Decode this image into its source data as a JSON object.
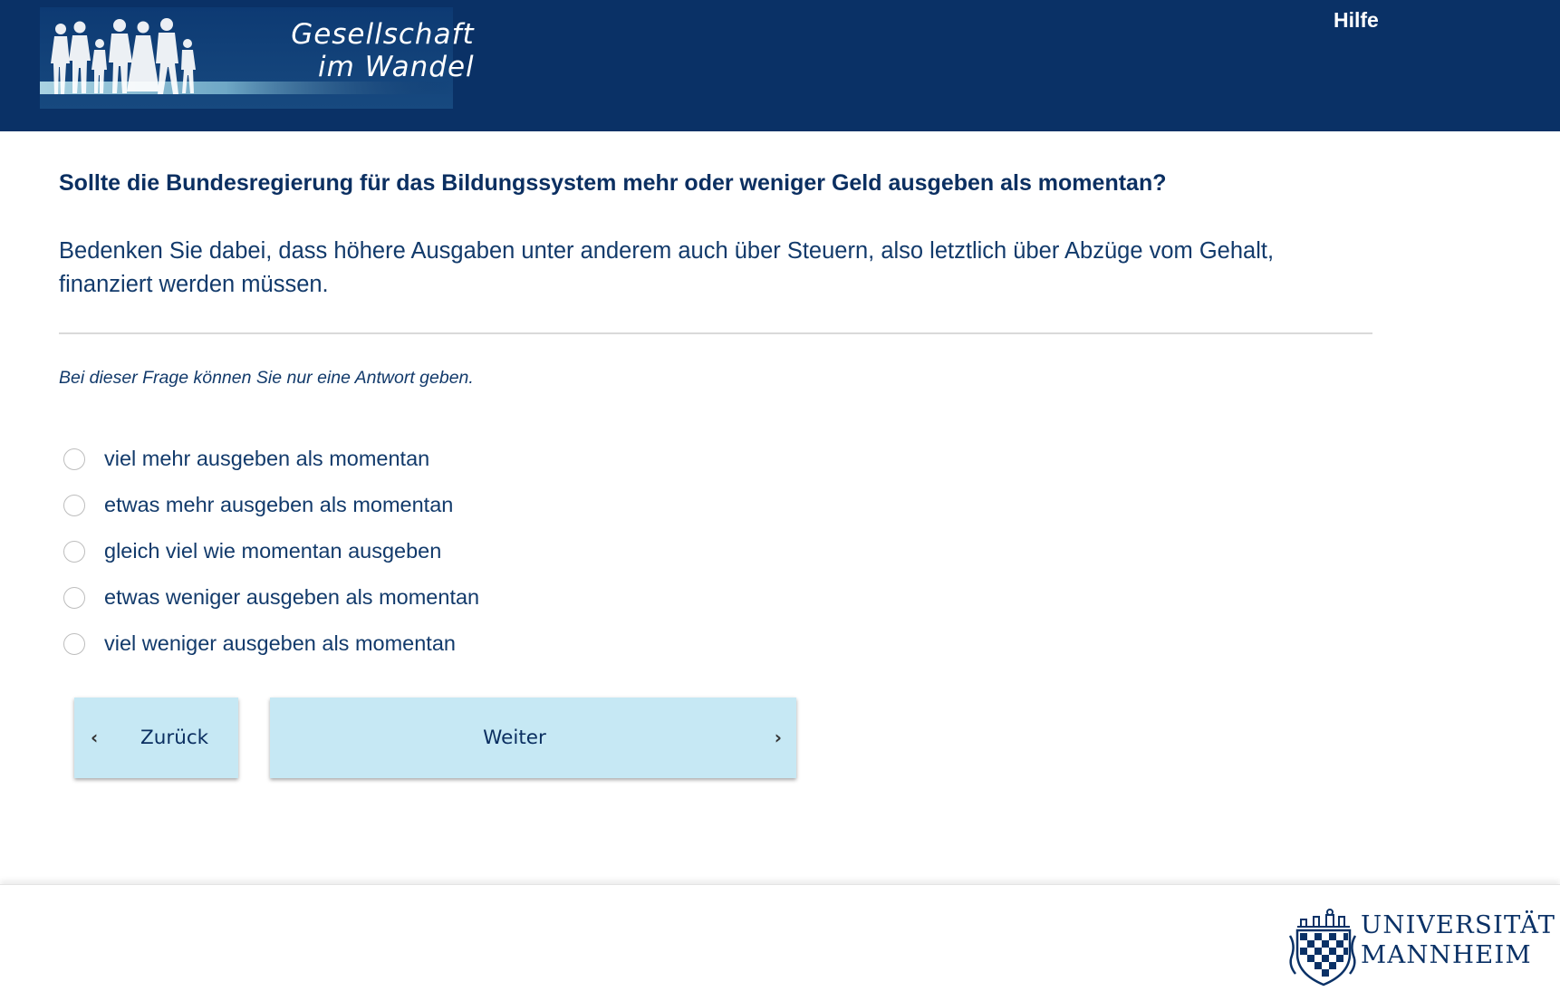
{
  "header": {
    "logo": {
      "title_line1": "Gesellschaft",
      "title_line2": "im Wandel"
    },
    "help_label": "Hilfe"
  },
  "question": {
    "title": "Sollte die Bundesregierung für das Bildungssystem mehr oder weniger Geld ausgeben als momentan?",
    "hint": "Bedenken Sie dabei, dass höhere Ausgaben unter anderem auch über Steuern, also letztlich über Abzüge vom Gehalt, finanziert werden müssen.",
    "instruction": "Bei dieser Frage können Sie nur eine Antwort geben.",
    "options": [
      {
        "label": "viel mehr ausgeben als momentan",
        "selected": false
      },
      {
        "label": "etwas mehr ausgeben als momentan",
        "selected": false
      },
      {
        "label": "gleich viel wie momentan ausgeben",
        "selected": false
      },
      {
        "label": "etwas weniger ausgeben als momentan",
        "selected": false
      },
      {
        "label": "viel weniger ausgeben als momentan",
        "selected": false
      }
    ]
  },
  "navigation": {
    "back_label": "Zurück",
    "next_label": "Weiter",
    "back_icon": "chevron-left-icon",
    "next_icon": "chevron-right-icon"
  },
  "footer": {
    "university_line1": "UNIVERSITÄT",
    "university_line2": "MANNHEIM"
  },
  "colors": {
    "header_bg": "#0a3166",
    "text": "#0b2f61",
    "button_bg": "#c6e8f4",
    "divider": "#d9d9d9"
  }
}
